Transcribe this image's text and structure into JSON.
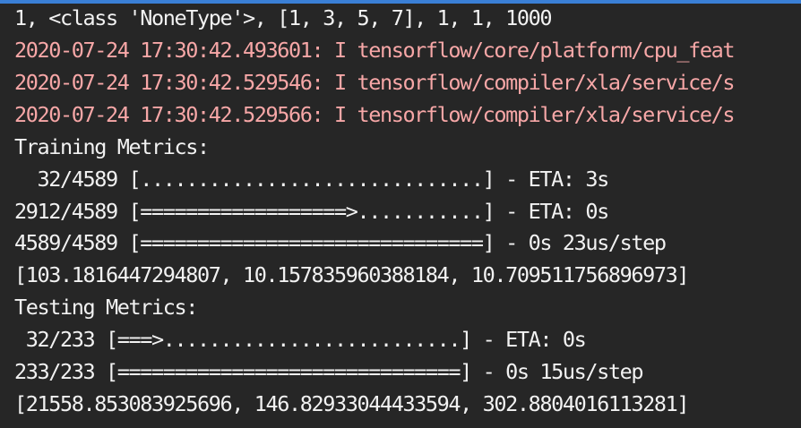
{
  "colors": {
    "background": "#262626",
    "text": "#f2f2f2",
    "stderr_text": "#f7a7a7",
    "top_accent": "#3a7fd6"
  },
  "terminal": {
    "lines": [
      {
        "text": "1, <class 'NoneType'>, [1, 3, 5, 7], 1, 1, 1000",
        "kind": "stdout"
      },
      {
        "text": "2020-07-24 17:30:42.493601: I tensorflow/core/platform/cpu_feat",
        "kind": "stderr"
      },
      {
        "text": "2020-07-24 17:30:42.529546: I tensorflow/compiler/xla/service/s",
        "kind": "stderr"
      },
      {
        "text": "2020-07-24 17:30:42.529566: I tensorflow/compiler/xla/service/s",
        "kind": "stderr"
      },
      {
        "text": "Training Metrics:",
        "kind": "stdout"
      },
      {
        "text": "  32/4589 [..............................] - ETA: 3s",
        "kind": "stdout"
      },
      {
        "text": "2912/4589 [==================>...........] - ETA: 0s",
        "kind": "stdout"
      },
      {
        "text": "4589/4589 [==============================] - 0s 23us/step",
        "kind": "stdout"
      },
      {
        "text": "[103.1816447294807, 10.157835960388184, 10.709511756896973]",
        "kind": "stdout"
      },
      {
        "text": "Testing Metrics:",
        "kind": "stdout"
      },
      {
        "text": " 32/233 [===>..........................] - ETA: 0s",
        "kind": "stdout"
      },
      {
        "text": "233/233 [==============================] - 0s 15us/step",
        "kind": "stdout"
      },
      {
        "text": "[21558.853083925696, 146.82933044433594, 302.8804016113281]",
        "kind": "stdout"
      }
    ]
  }
}
